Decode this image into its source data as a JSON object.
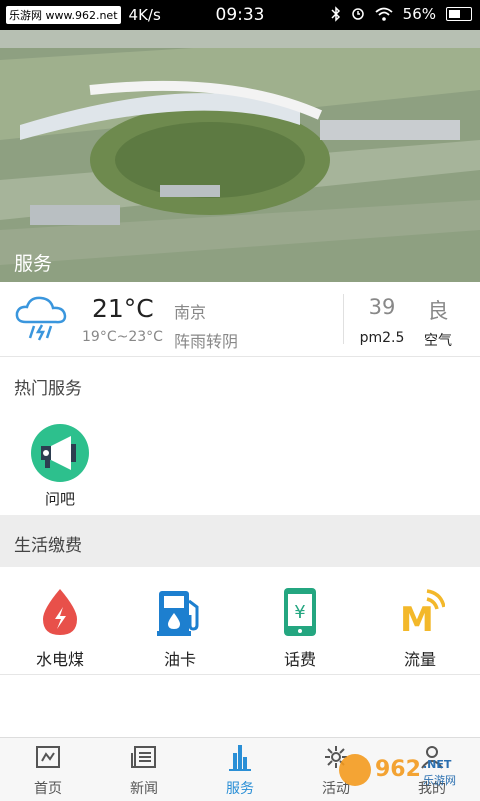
{
  "status_bar": {
    "watermark": "乐游网 www.962.net",
    "speed": "4K/s",
    "time": "09:33",
    "battery": "56%"
  },
  "banner": {
    "label": "服务"
  },
  "weather": {
    "temperature": "21°C",
    "range": "19°C~23°C",
    "city": "南京",
    "condition": "阵雨转阴",
    "pm25_value": "39",
    "pm25_label": "pm2.5",
    "air_quality_value": "良",
    "air_quality_label": "空气"
  },
  "hot_services": {
    "title": "热门服务",
    "items": [
      {
        "label": "问吧",
        "icon": "megaphone-icon"
      }
    ]
  },
  "life_payment": {
    "title": "生活缴费",
    "items": [
      {
        "label": "水电煤",
        "icon": "water-drop-icon"
      },
      {
        "label": "油卡",
        "icon": "gas-pump-icon"
      },
      {
        "label": "话费",
        "icon": "phone-yuan-icon"
      },
      {
        "label": "流量",
        "icon": "data-signal-icon"
      }
    ]
  },
  "tab_bar": {
    "items": [
      {
        "label": "首页",
        "icon": "home-icon"
      },
      {
        "label": "新闻",
        "icon": "news-icon"
      },
      {
        "label": "服务",
        "icon": "service-tower-icon",
        "active": true
      },
      {
        "label": "活动",
        "icon": "activity-icon"
      },
      {
        "label": "我的",
        "icon": "profile-icon"
      }
    ]
  },
  "watermark_logo": "962.NET 乐游网",
  "colors": {
    "accent": "#2a8fd6",
    "green": "#2dc08d",
    "red": "#e8504a",
    "yellow": "#f3b82a"
  }
}
